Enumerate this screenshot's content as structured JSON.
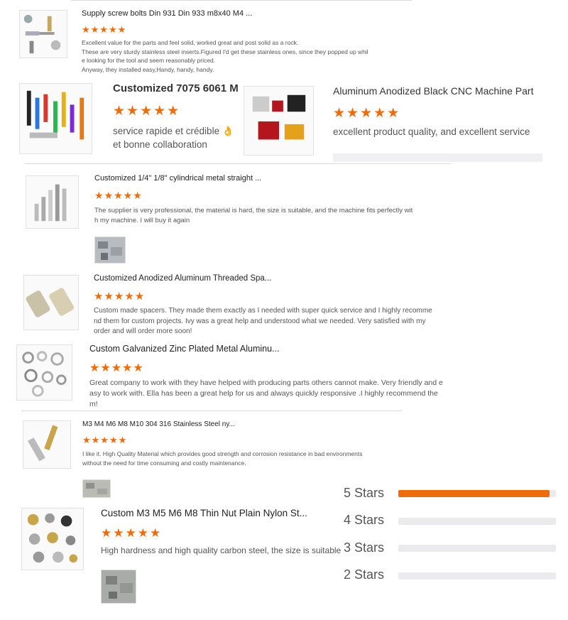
{
  "reviews": [
    {
      "title": "Supply screw bolts Din 931 Din 933 m8x40 M4 ...",
      "stars": "★★★★★",
      "lines": [
        "Excellent value for the parts and feel solid, worked great and post solid as a rock.",
        "These are very sturdy stainless steel inserts.Figured I'd get these stainless ones, since they popped up whil",
        "e looking for the tool and seem reasonably priced.",
        "Anyway, they installed easy,Handy, handy, handy."
      ]
    },
    {
      "title": "Customized 7075 6061 M",
      "stars": "★★★★★",
      "lines": [
        "service rapide et crédible 👌",
        "et bonne collaboration"
      ]
    },
    {
      "title": "Aluminum Anodized Black CNC Machine Part",
      "stars": "★★★★★",
      "lines": [
        "excellent product quality, and excellent service"
      ]
    },
    {
      "title": "Customized 1/4\" 1/8\" cylindrical metal straight ...",
      "stars": "★★★★★",
      "lines": [
        "The supplier is very professional, the material is hard, the size is suitable, and the machine fits perfectly wit",
        "h my machine. I will buy it again"
      ]
    },
    {
      "title": "Customized Anodized Aluminum Threaded Spa...",
      "stars": "★★★★★",
      "lines": [
        "Custom made spacers. They made them exactly as I needed with super quick service and I highly recomme",
        "nd them for custom projects. Ivy was a great help and understood what we needed. Very satisfied with my",
        "order and will order more soon!"
      ]
    },
    {
      "title": "Custom Galvanized Zinc Plated Metal Aluminu...",
      "stars": "★★★★★",
      "lines": [
        "Great company to work with they have helped with producing parts others cannot make. Very friendly and e",
        "asy to work with. Ella has been a great help for us and always quickly responsive .I highly recommend the",
        "m!"
      ]
    },
    {
      "title": "M3 M4 M6 M8 M10 304 316 Stainless Steel ny...",
      "stars": "★★★★★",
      "lines": [
        "I like it. High Quality Material which provides good strength and corrosion resistance in bad environments",
        "without the need for time consuming and costly maintenance."
      ]
    },
    {
      "title": "Custom M3 M5 M6 M8 Thin Nut Plain Nylon St...",
      "stars": "★★★★★",
      "lines": [
        "High hardness and high quality carbon steel, the size is suitable"
      ]
    }
  ],
  "rating_breakdown": [
    {
      "label": "5 Stars",
      "fraction": 0.96
    },
    {
      "label": "4 Stars",
      "fraction": 0.0
    },
    {
      "label": "3 Stars",
      "fraction": 0.0
    },
    {
      "label": "2 Stars",
      "fraction": 0.0
    }
  ],
  "colors": {
    "star": "#f06b0a",
    "bar_fill": "#f06b0a",
    "bar_track": "#ebebee"
  }
}
